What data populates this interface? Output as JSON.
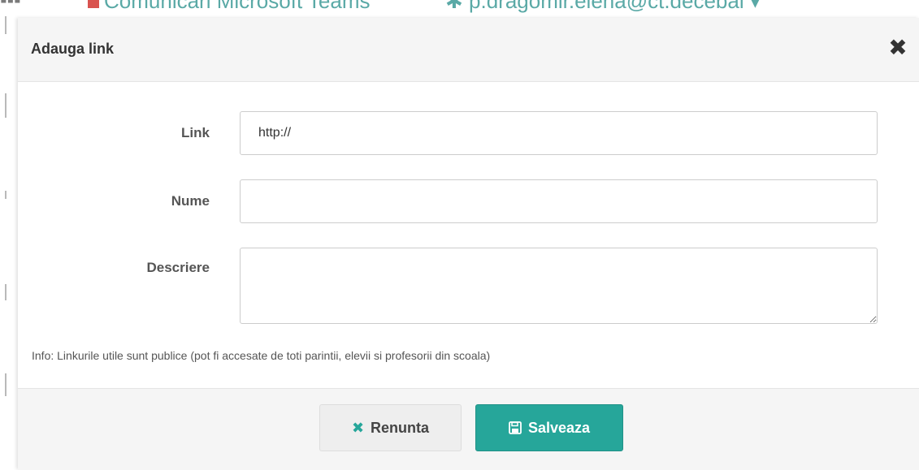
{
  "background": {
    "app_name": "Comunicari Microsoft Teams",
    "user_label": "p.dragomir.elena@ct.decebal"
  },
  "dialog": {
    "title": "Adauga link",
    "close_label": "✖",
    "fields": {
      "link": {
        "label": "Link",
        "value": "http://"
      },
      "name": {
        "label": "Nume",
        "value": ""
      },
      "description": {
        "label": "Descriere",
        "value": ""
      }
    },
    "info": "Info: Linkurile utile sunt publice (pot fi accesate de toti parintii, elevii si profesorii din scoala)",
    "buttons": {
      "cancel_label": "Renunta",
      "save_label": "Salveaza"
    }
  },
  "colors": {
    "accent": "#26a69a",
    "header_bg": "#f5f5f5"
  },
  "icons": {
    "close": "close-icon",
    "cancel": "times-icon",
    "save": "floppy-disk-icon"
  }
}
